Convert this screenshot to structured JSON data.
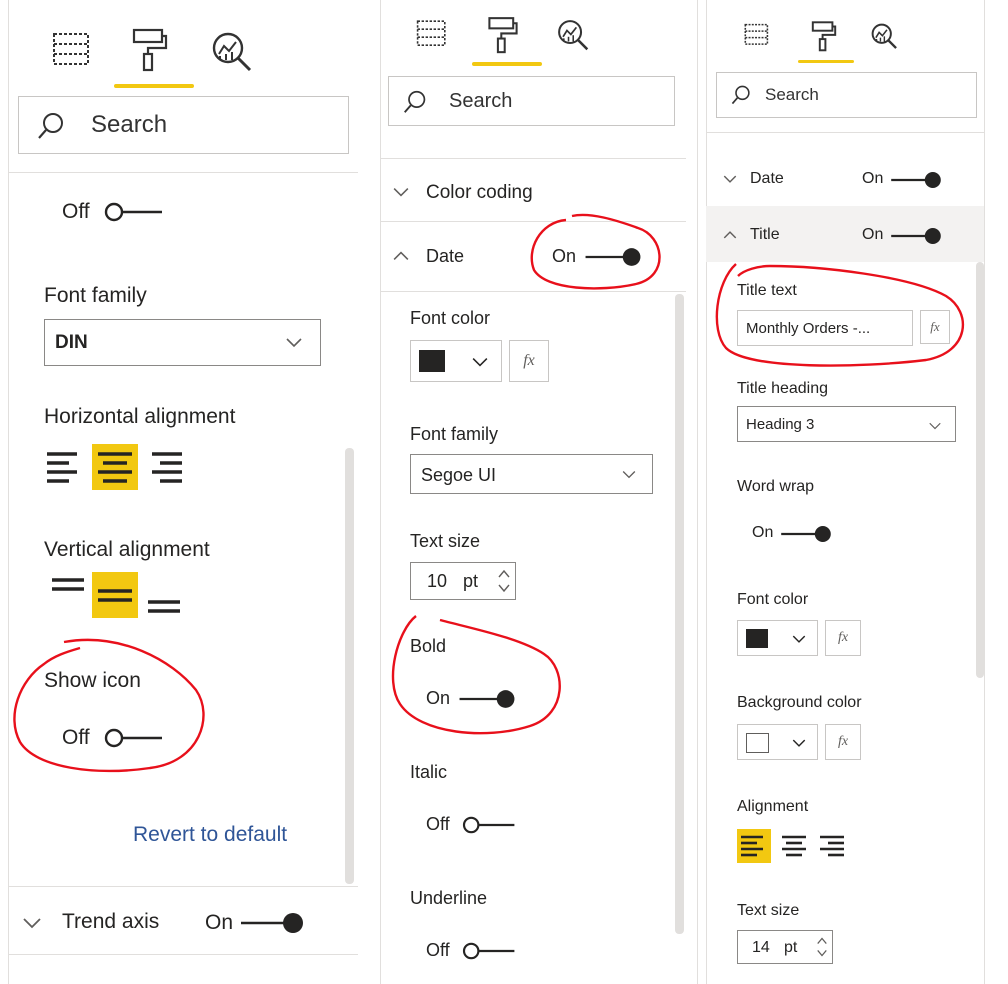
{
  "colors": {
    "accent": "#f2c811",
    "annotation": "#e8101b",
    "text": "#252423",
    "link": "#2f5597",
    "swatch_black": "#252423"
  },
  "panels": [
    {
      "tabs": [
        "fields-icon",
        "format-paint-roller-icon",
        "analytics-magnifier-icon"
      ],
      "search": {
        "placeholder": "Search"
      },
      "top_toggle": {
        "label": "Off"
      },
      "font_family": {
        "label": "Font family",
        "value": "DIN"
      },
      "horizontal_alignment": {
        "label": "Horizontal alignment",
        "selected": "center"
      },
      "vertical_alignment": {
        "label": "Vertical alignment",
        "selected": "middle"
      },
      "show_icon": {
        "label": "Show icon",
        "toggle": "Off"
      },
      "revert": {
        "label": "Revert to default"
      },
      "trend_axis": {
        "label": "Trend axis",
        "toggle": "On"
      }
    },
    {
      "tabs": [
        "fields-icon",
        "format-paint-roller-icon",
        "analytics-magnifier-icon"
      ],
      "search": {
        "placeholder": "Search"
      },
      "color_coding": {
        "label": "Color coding"
      },
      "date": {
        "label": "Date",
        "toggle": "On"
      },
      "font_color": {
        "label": "Font color",
        "fx": "fx"
      },
      "font_family": {
        "label": "Font family",
        "value": "Segoe UI"
      },
      "text_size": {
        "label": "Text size",
        "value": "10",
        "unit": "pt"
      },
      "bold": {
        "label": "Bold",
        "toggle": "On"
      },
      "italic": {
        "label": "Italic",
        "toggle": "Off"
      },
      "underline": {
        "label": "Underline",
        "toggle": "Off"
      }
    },
    {
      "tabs": [
        "fields-icon",
        "format-paint-roller-icon",
        "analytics-magnifier-icon"
      ],
      "search": {
        "placeholder": "Search"
      },
      "date": {
        "label": "Date",
        "toggle": "On"
      },
      "title": {
        "label": "Title",
        "toggle": "On"
      },
      "title_text": {
        "label": "Title text",
        "value": "Monthly Orders -...",
        "fx": "fx"
      },
      "title_heading": {
        "label": "Title heading",
        "value": "Heading 3"
      },
      "word_wrap": {
        "label": "Word wrap",
        "toggle": "On"
      },
      "font_color": {
        "label": "Font color",
        "fx": "fx"
      },
      "background_color": {
        "label": "Background color",
        "fx": "fx"
      },
      "alignment": {
        "label": "Alignment",
        "selected": "left"
      },
      "text_size": {
        "label": "Text size",
        "value": "14",
        "unit": "pt"
      }
    }
  ]
}
